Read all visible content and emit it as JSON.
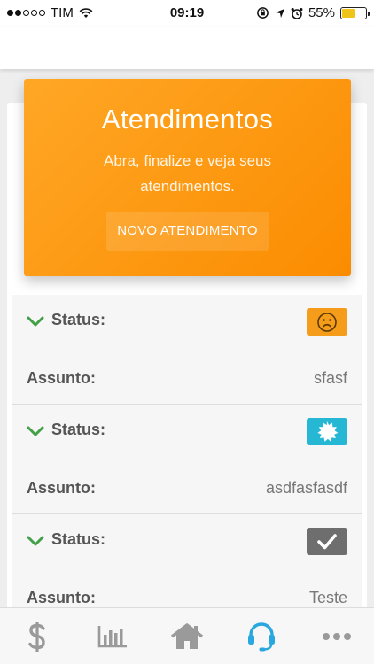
{
  "status_bar": {
    "carrier": "TIM",
    "time": "09:19",
    "battery": "55%",
    "signal_filled": 2,
    "battery_level": 0.55
  },
  "hero": {
    "title": "Atendimentos",
    "subtitle": "Abra, finalize e veja seus atendimentos.",
    "button_label": "NOVO ATENDIMENTO",
    "color": "#fb8c00"
  },
  "tickets": [
    {
      "status_label": "Status:",
      "subject_label": "Assunto:",
      "subject": "sfasf",
      "status_icon": "sad-face-icon",
      "status_color": "#f59c1a"
    },
    {
      "status_label": "Status:",
      "subject_label": "Assunto:",
      "subject": "asdfasfasdf",
      "status_icon": "starburst-icon",
      "status_color": "#26b7d4"
    },
    {
      "status_label": "Status:",
      "subject_label": "Assunto:",
      "subject": "Teste",
      "status_icon": "checkmark-icon",
      "status_color": "#6e6e6e"
    }
  ],
  "tabs": [
    {
      "icon": "dollar-icon",
      "active": false
    },
    {
      "icon": "bar-chart-icon",
      "active": false
    },
    {
      "icon": "home-icon",
      "active": false
    },
    {
      "icon": "headset-icon",
      "active": true
    },
    {
      "icon": "more-icon",
      "active": false
    }
  ],
  "colors": {
    "accent": "#29a8e0",
    "tab_inactive": "#9a9a9a",
    "check": "#43a047"
  }
}
